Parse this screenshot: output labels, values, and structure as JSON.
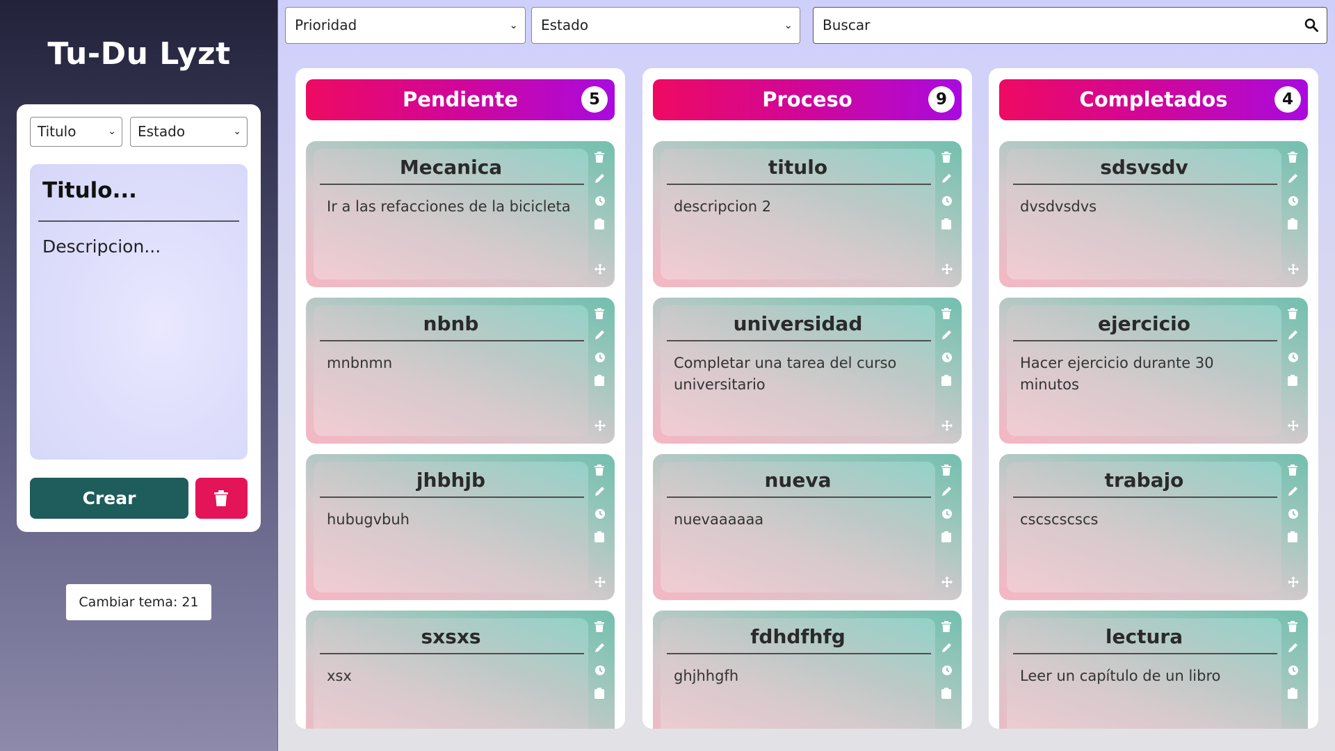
{
  "sidebar": {
    "app_title": "Tu-Du Lyzt",
    "form": {
      "sort_select": "Titulo",
      "state_select": "Estado",
      "title_placeholder": "Titulo...",
      "desc_placeholder": "Descripcion...",
      "create_label": "Crear"
    },
    "theme_label": "Cambiar tema: 21"
  },
  "toolbar": {
    "priority_select": "Prioridad",
    "state_select": "Estado",
    "search_placeholder": "Buscar"
  },
  "colors": {
    "header_gradient": [
      "#ee0a62",
      "#aa0ae0"
    ],
    "create_button": "#1f5c5c",
    "delete_button": "#e41458"
  },
  "columns": [
    {
      "title": "Pendiente",
      "count": "5",
      "tasks": [
        {
          "title": "Mecanica",
          "desc": "Ir a las refacciones de la bicicleta"
        },
        {
          "title": "nbnb",
          "desc": "mnbnmn"
        },
        {
          "title": "jhbhjb",
          "desc": "hubugvbuh"
        },
        {
          "title": "sxsxs",
          "desc": "xsx"
        }
      ]
    },
    {
      "title": "Proceso",
      "count": "9",
      "tasks": [
        {
          "title": "titulo",
          "desc": "descripcion 2"
        },
        {
          "title": "universidad",
          "desc": "Completar una tarea del curso universitario"
        },
        {
          "title": "nueva",
          "desc": "nuevaaaaaa"
        },
        {
          "title": "fdhdfhfg",
          "desc": "ghjhhgfh"
        }
      ]
    },
    {
      "title": "Completados",
      "count": "4",
      "tasks": [
        {
          "title": "sdsvsdv",
          "desc": "dvsdvsdvs"
        },
        {
          "title": "ejercicio",
          "desc": "Hacer ejercicio durante 30 minutos"
        },
        {
          "title": "trabajo",
          "desc": "cscscscscs"
        },
        {
          "title": "lectura",
          "desc": "Leer un capítulo de un libro"
        }
      ]
    }
  ],
  "task_tools": [
    "trash-icon",
    "pencil-icon",
    "clock-icon",
    "clipboard-icon",
    "move-icon"
  ]
}
